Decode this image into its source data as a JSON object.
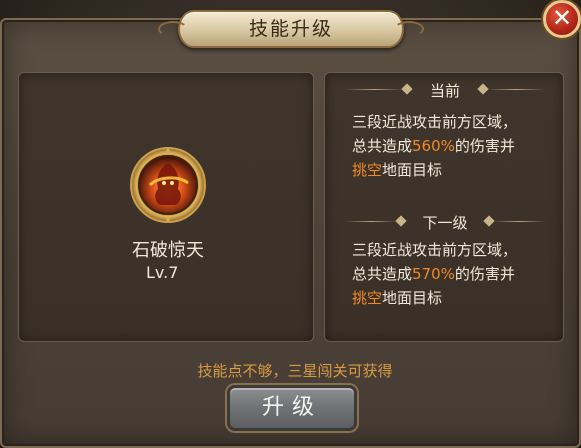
{
  "dialog": {
    "title": "技能升级",
    "close_label": "✕"
  },
  "skill": {
    "name": "石破惊天",
    "level": "Lv.7",
    "icon": "flame-warrior-skill-icon"
  },
  "current": {
    "header": "当前",
    "line1": "三段近战攻击前方区域，",
    "line2_pre": "总共造成",
    "line2_value": "560%",
    "line2_post": "的伤害并",
    "line3_highlight": "挑空",
    "line3_post": "地面目标"
  },
  "next": {
    "header": "下一级",
    "line1": "三段近战攻击前方区域，",
    "line2_pre": "总共造成",
    "line2_value": "570%",
    "line2_post": "的伤害并",
    "line3_highlight": "挑空",
    "line3_post": "地面目标"
  },
  "notice": "技能点不够，三星闯关可获得",
  "upgrade_button": "升级",
  "colors": {
    "highlight": "#f08a2a",
    "notice": "#d99a45",
    "text": "#f2ead8"
  }
}
